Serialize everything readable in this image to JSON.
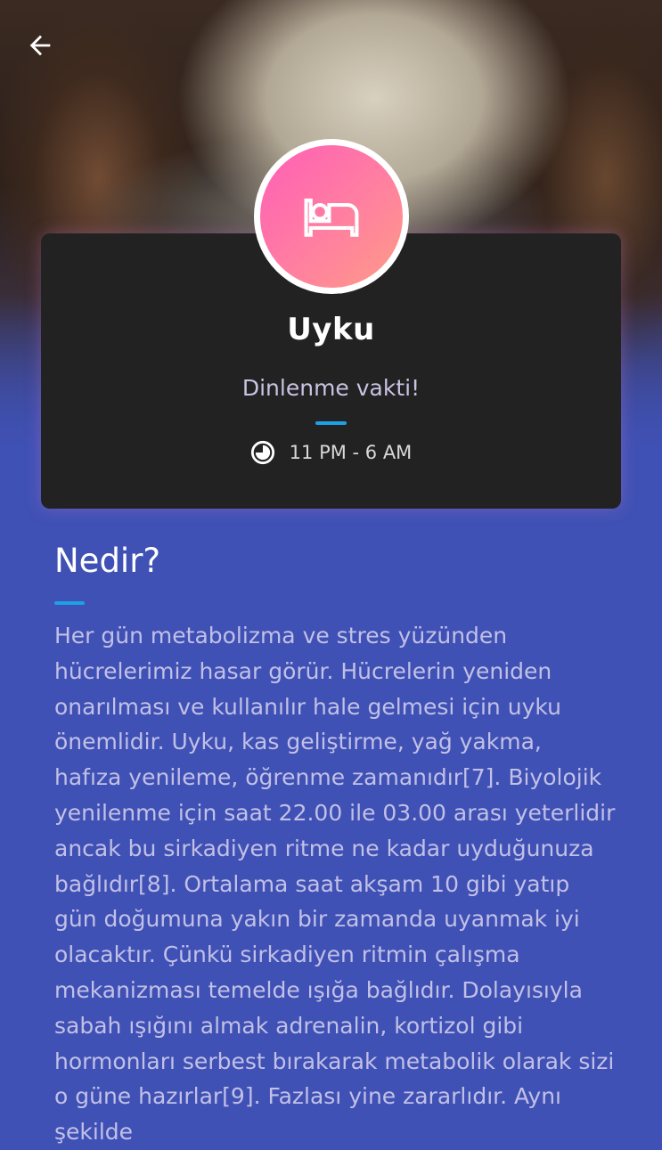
{
  "header": {
    "back_icon": "arrow-left-icon"
  },
  "card": {
    "icon": "bed-icon",
    "title": "Uyku",
    "subtitle": "Dinlenme vakti!",
    "time_icon": "clock-icon",
    "time_range": "11 PM - 6 AM"
  },
  "section": {
    "title": "Nedir?",
    "body": "Her gün metabolizma ve stres yüzünden hücrelerimiz hasar görür. Hücrelerin yeniden onarılması ve kullanılır hale gelmesi için uyku önemlidir. Uyku, kas geliştirme, yağ yakma, hafıza yenileme, öğrenme zamanıdır[7]. Biyolojik yenilenme için saat 22.00 ile 03.00 arası yeterlidir ancak bu sirkadiyen ritme ne kadar uyduğunuza bağlıdır[8]. Ortalama saat akşam 10 gibi yatıp gün doğumuna yakın bir zamanda uyanmak iyi olacaktır. Çünkü sirkadiyen ritmin çalışma mekanizması temelde ışığa bağlıdır. Dolayısıyla sabah ışığını almak adrenalin, kortizol gibi hormonları serbest bırakarak metabolik olarak sizi o güne hazırlar[9]. Fazlası yine zararlıdır. Aynı şekilde"
  },
  "colors": {
    "background": "#3f51b5",
    "card": "#222222",
    "accent": "#1ea0e6",
    "avatar_gradient_start": "#ff5fb6",
    "avatar_gradient_end": "#ff9c86"
  }
}
